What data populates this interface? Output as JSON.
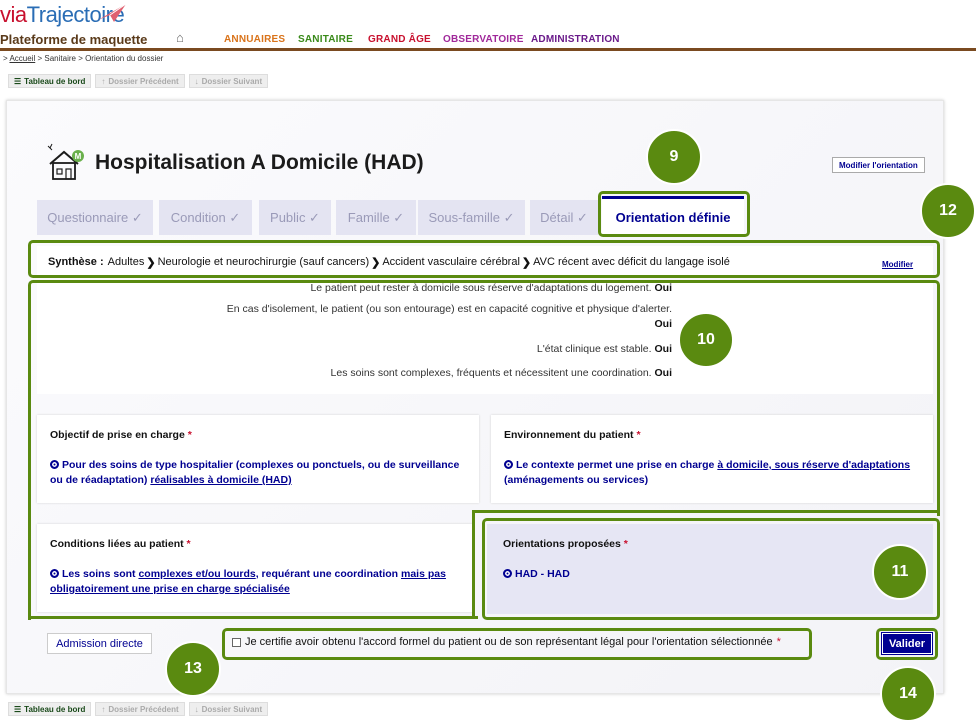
{
  "header": {
    "logo_prefix": "via",
    "logo_main": "Trajectoire",
    "app_title": "Plateforme de maquette",
    "nav": [
      {
        "label": "ANNUAIRES",
        "color": "#d9731a"
      },
      {
        "label": "SANITAIRE",
        "color": "#3a8a1a"
      },
      {
        "label": "GRAND ÂGE",
        "color": "#c8102e"
      },
      {
        "label": "OBSERVATOIRE",
        "color": "#a0289a"
      },
      {
        "label": "ADMINISTRATION",
        "color": "#6a1a8a"
      }
    ],
    "home_icon": "home-icon"
  },
  "breadcrumb": {
    "prefix": ">",
    "home": "Accueil",
    "sep": ">",
    "path_rest": "Sanitaire > Orientation du dossier"
  },
  "toolbar": {
    "dashboard": "Tableau de bord",
    "prev": "Dossier Précédent",
    "next": "Dossier Suivant"
  },
  "page": {
    "title": "Hospitalisation A Domicile (HAD)",
    "modify_orientation": "Modifier l'orientation"
  },
  "tabs": [
    {
      "label": "Questionnaire ✓"
    },
    {
      "label": "Condition ✓"
    },
    {
      "label": "Public ✓"
    },
    {
      "label": "Famille ✓"
    },
    {
      "label": "Sous-famille ✓"
    },
    {
      "label": "Détail ✓"
    },
    {
      "label": "Orientation définie",
      "active": true
    }
  ],
  "synthese": {
    "label": "Synthèse :",
    "steps": [
      "Adultes",
      "Neurologie et neurochirurgie (sauf cancers)",
      "Accident vasculaire cérébral",
      "AVC récent avec déficit du langage isolé"
    ],
    "modify": "Modifier"
  },
  "answers": [
    {
      "q": "Le patient peut rester à domicile sous réserve d'adaptations du logement.",
      "a": "Oui"
    },
    {
      "q": "En cas d'isolement, le patient (ou son entourage) est en capacité cognitive et physique d'alerter.",
      "a": "Oui"
    },
    {
      "q": "L'état clinique est stable.",
      "a": "Oui"
    },
    {
      "q": "Les soins sont complexes, fréquents et nécessitent une coordination.",
      "a": "Oui"
    }
  ],
  "objectif": {
    "label": "Objectif de prise en charge",
    "req": "*",
    "text_a": "Pour des soins de type hospitalier (complexes ou ponctuels, ou de surveillance ou de réadaptation)",
    "text_link": "réalisables à domicile (HAD)"
  },
  "environnement": {
    "label": "Environnement du patient",
    "req": "*",
    "text_a": "Le contexte permet une prise en charge",
    "text_link": "à domicile, sous réserve d'adaptations",
    "text_b": "(aménagements ou services)"
  },
  "conditions": {
    "label": "Conditions liées au patient",
    "req": "*",
    "text_a": "Les soins sont",
    "text_link1": "complexes et/ou lourds",
    "text_b": ", requérant une coordination",
    "text_link2": "mais pas obligatoirement une prise en charge spécialisée"
  },
  "orientations": {
    "label": "Orientations proposées",
    "req": "*",
    "option": "HAD - HAD"
  },
  "footer": {
    "admission": "Admission directe",
    "certify": "Je certifie avoir obtenu l'accord formel du patient ou de son représentant légal pour l'orientation sélectionnée",
    "req": "*",
    "valider": "Valider"
  },
  "annotations": {
    "b9": "9",
    "b10": "10",
    "b11": "11",
    "b12": "12",
    "b13": "13",
    "b14": "14",
    "color": "#5a8a10"
  }
}
